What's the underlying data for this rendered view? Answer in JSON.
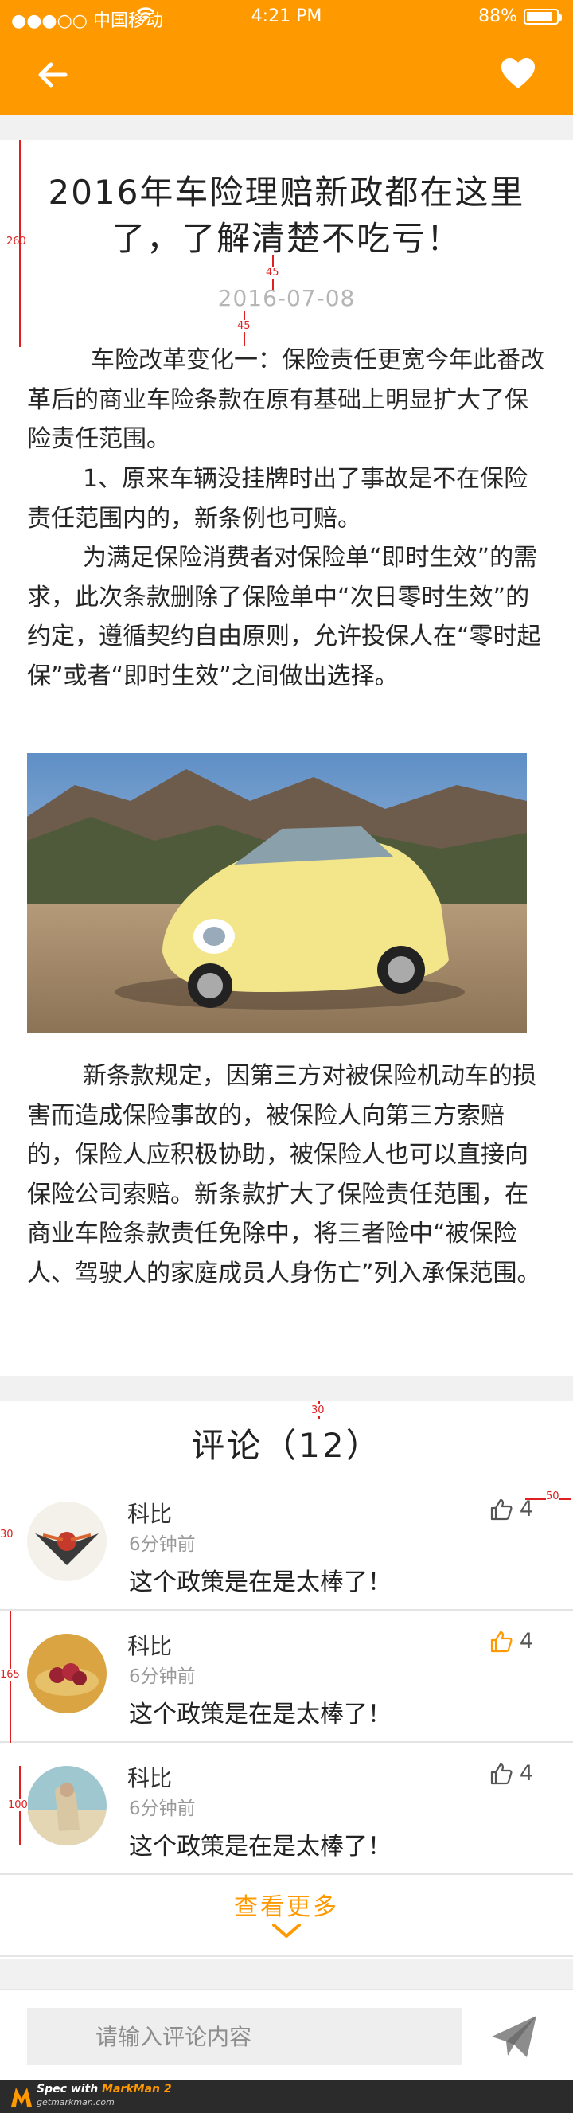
{
  "status_bar": {
    "carrier": "●●●○○ 中国移动",
    "time": "4:21 PM",
    "battery": "88%",
    "battery_level": 0.88
  },
  "nav": {
    "back_icon": "arrow-left-icon",
    "favorite_icon": "heart-icon"
  },
  "article": {
    "title": "2016年车险理赔新政都在这里了，了解清楚不吃亏！",
    "date": "2016-07-08",
    "paragraphs": [
      "车险改革变化一：保险责任更宽今年此番改革后的商业车险条款在原有基础上明显扩大了保险责任范围。",
      "1、原来车辆没挂牌时出了事故是不在保险责任范围内的，新条例也可赔。",
      "为满足保险消费者对保险单“即时生效”的需求，此次条款删除了保险单中“次日零时生效”的约定，遵循契约自由原则，允许投保人在“零时起保”或者“即时生效”之间做出选择。",
      "新条款规定，因第三方对被保险机动车的损害而造成保险事故的，被保险人向第三方索赔的，保险人应积极协助，被保险人也可以直接向保险公司索赔。新条款扩大了保险责任范围，在商业车险条款责任免除中，将三者险中“被保险人、驾驶人的家庭成员人身伤亡”列入承保范围。"
    ]
  },
  "comments": {
    "title": "评论（12）",
    "items": [
      {
        "name": "科比",
        "time": "6分钟前",
        "text": "这个政策是在是太棒了！",
        "likes": "4",
        "liked": false
      },
      {
        "name": "科比",
        "time": "6分钟前",
        "text": "这个政策是在是太棒了！",
        "likes": "4",
        "liked": true
      },
      {
        "name": "科比",
        "time": "6分钟前",
        "text": "这个政策是在是太棒了！",
        "likes": "4",
        "liked": false
      }
    ],
    "more_label": "查看更多"
  },
  "input": {
    "placeholder": "请输入评论内容",
    "send_icon": "paper-plane-icon"
  },
  "annotations": {
    "title_block": "260",
    "gap_title_date": "45",
    "gap_date_text": "45",
    "gap_section": "30",
    "right_margin": "50",
    "avatar_margin": "30",
    "row_height": "165",
    "avatar_size": "100"
  },
  "footer": {
    "line1_prefix": "Spec with ",
    "line1_brand": "MarkMan 2",
    "line2": "getmarkman.com"
  },
  "colors": {
    "accent": "#ff9900",
    "gap": "#f1f1f1",
    "annotation": "#e02020"
  }
}
